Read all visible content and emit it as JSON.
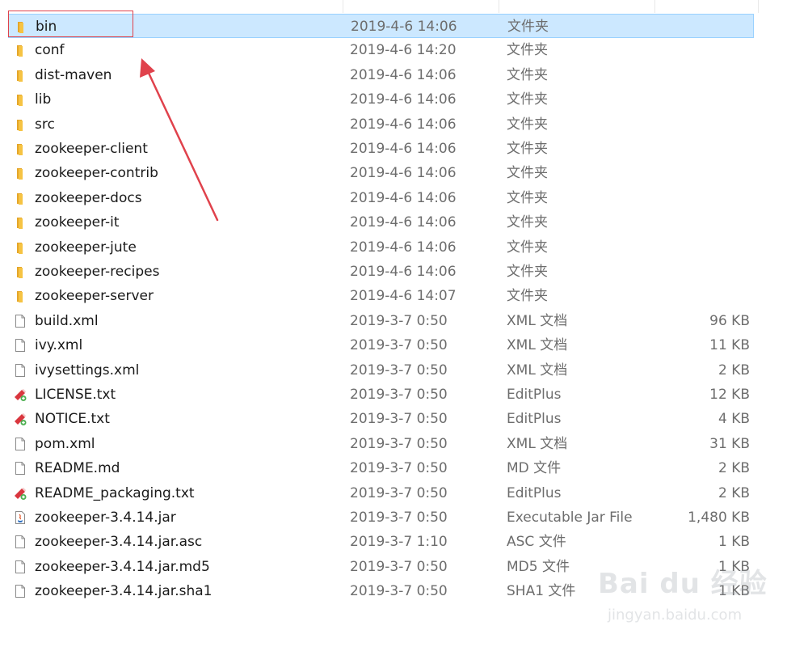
{
  "files": [
    {
      "name": "bin",
      "date": "2019-4-6 14:06",
      "type": "文件夹",
      "size": "",
      "icon": "folder-icon",
      "selected": true
    },
    {
      "name": "conf",
      "date": "2019-4-6 14:20",
      "type": "文件夹",
      "size": "",
      "icon": "folder-icon"
    },
    {
      "name": "dist-maven",
      "date": "2019-4-6 14:06",
      "type": "文件夹",
      "size": "",
      "icon": "folder-icon"
    },
    {
      "name": "lib",
      "date": "2019-4-6 14:06",
      "type": "文件夹",
      "size": "",
      "icon": "folder-icon"
    },
    {
      "name": "src",
      "date": "2019-4-6 14:06",
      "type": "文件夹",
      "size": "",
      "icon": "folder-icon"
    },
    {
      "name": "zookeeper-client",
      "date": "2019-4-6 14:06",
      "type": "文件夹",
      "size": "",
      "icon": "folder-icon"
    },
    {
      "name": "zookeeper-contrib",
      "date": "2019-4-6 14:06",
      "type": "文件夹",
      "size": "",
      "icon": "folder-icon"
    },
    {
      "name": "zookeeper-docs",
      "date": "2019-4-6 14:06",
      "type": "文件夹",
      "size": "",
      "icon": "folder-icon"
    },
    {
      "name": "zookeeper-it",
      "date": "2019-4-6 14:06",
      "type": "文件夹",
      "size": "",
      "icon": "folder-icon"
    },
    {
      "name": "zookeeper-jute",
      "date": "2019-4-6 14:06",
      "type": "文件夹",
      "size": "",
      "icon": "folder-icon"
    },
    {
      "name": "zookeeper-recipes",
      "date": "2019-4-6 14:06",
      "type": "文件夹",
      "size": "",
      "icon": "folder-icon"
    },
    {
      "name": "zookeeper-server",
      "date": "2019-4-6 14:07",
      "type": "文件夹",
      "size": "",
      "icon": "folder-icon"
    },
    {
      "name": "build.xml",
      "date": "2019-3-7 0:50",
      "type": "XML 文档",
      "size": "96 KB",
      "icon": "document-icon"
    },
    {
      "name": "ivy.xml",
      "date": "2019-3-7 0:50",
      "type": "XML 文档",
      "size": "11 KB",
      "icon": "document-icon"
    },
    {
      "name": "ivysettings.xml",
      "date": "2019-3-7 0:50",
      "type": "XML 文档",
      "size": "2 KB",
      "icon": "document-icon"
    },
    {
      "name": "LICENSE.txt",
      "date": "2019-3-7 0:50",
      "type": "EditPlus",
      "size": "12 KB",
      "icon": "editplus-icon"
    },
    {
      "name": "NOTICE.txt",
      "date": "2019-3-7 0:50",
      "type": "EditPlus",
      "size": "4 KB",
      "icon": "editplus-icon"
    },
    {
      "name": "pom.xml",
      "date": "2019-3-7 0:50",
      "type": "XML 文档",
      "size": "31 KB",
      "icon": "document-icon"
    },
    {
      "name": "README.md",
      "date": "2019-3-7 0:50",
      "type": "MD 文件",
      "size": "2 KB",
      "icon": "document-icon"
    },
    {
      "name": "README_packaging.txt",
      "date": "2019-3-7 0:50",
      "type": "EditPlus",
      "size": "2 KB",
      "icon": "editplus-icon"
    },
    {
      "name": "zookeeper-3.4.14.jar",
      "date": "2019-3-7 0:50",
      "type": "Executable Jar File",
      "size": "1,480 KB",
      "icon": "java-jar-icon"
    },
    {
      "name": "zookeeper-3.4.14.jar.asc",
      "date": "2019-3-7 1:10",
      "type": "ASC 文件",
      "size": "1 KB",
      "icon": "document-icon"
    },
    {
      "name": "zookeeper-3.4.14.jar.md5",
      "date": "2019-3-7 0:50",
      "type": "MD5 文件",
      "size": "1 KB",
      "icon": "document-icon"
    },
    {
      "name": "zookeeper-3.4.14.jar.sha1",
      "date": "2019-3-7 0:50",
      "type": "SHA1 文件",
      "size": "1 KB",
      "icon": "document-icon"
    }
  ],
  "colors": {
    "selection_bg": "#cce8ff",
    "selection_border": "#99d1ff",
    "annotation_red": "#e0424c",
    "folder_yellow": "#f6c343",
    "meta_text": "#6d6d6d"
  },
  "watermark": {
    "logo": "Bai du 经验",
    "url": "jingyan.baidu.com"
  }
}
